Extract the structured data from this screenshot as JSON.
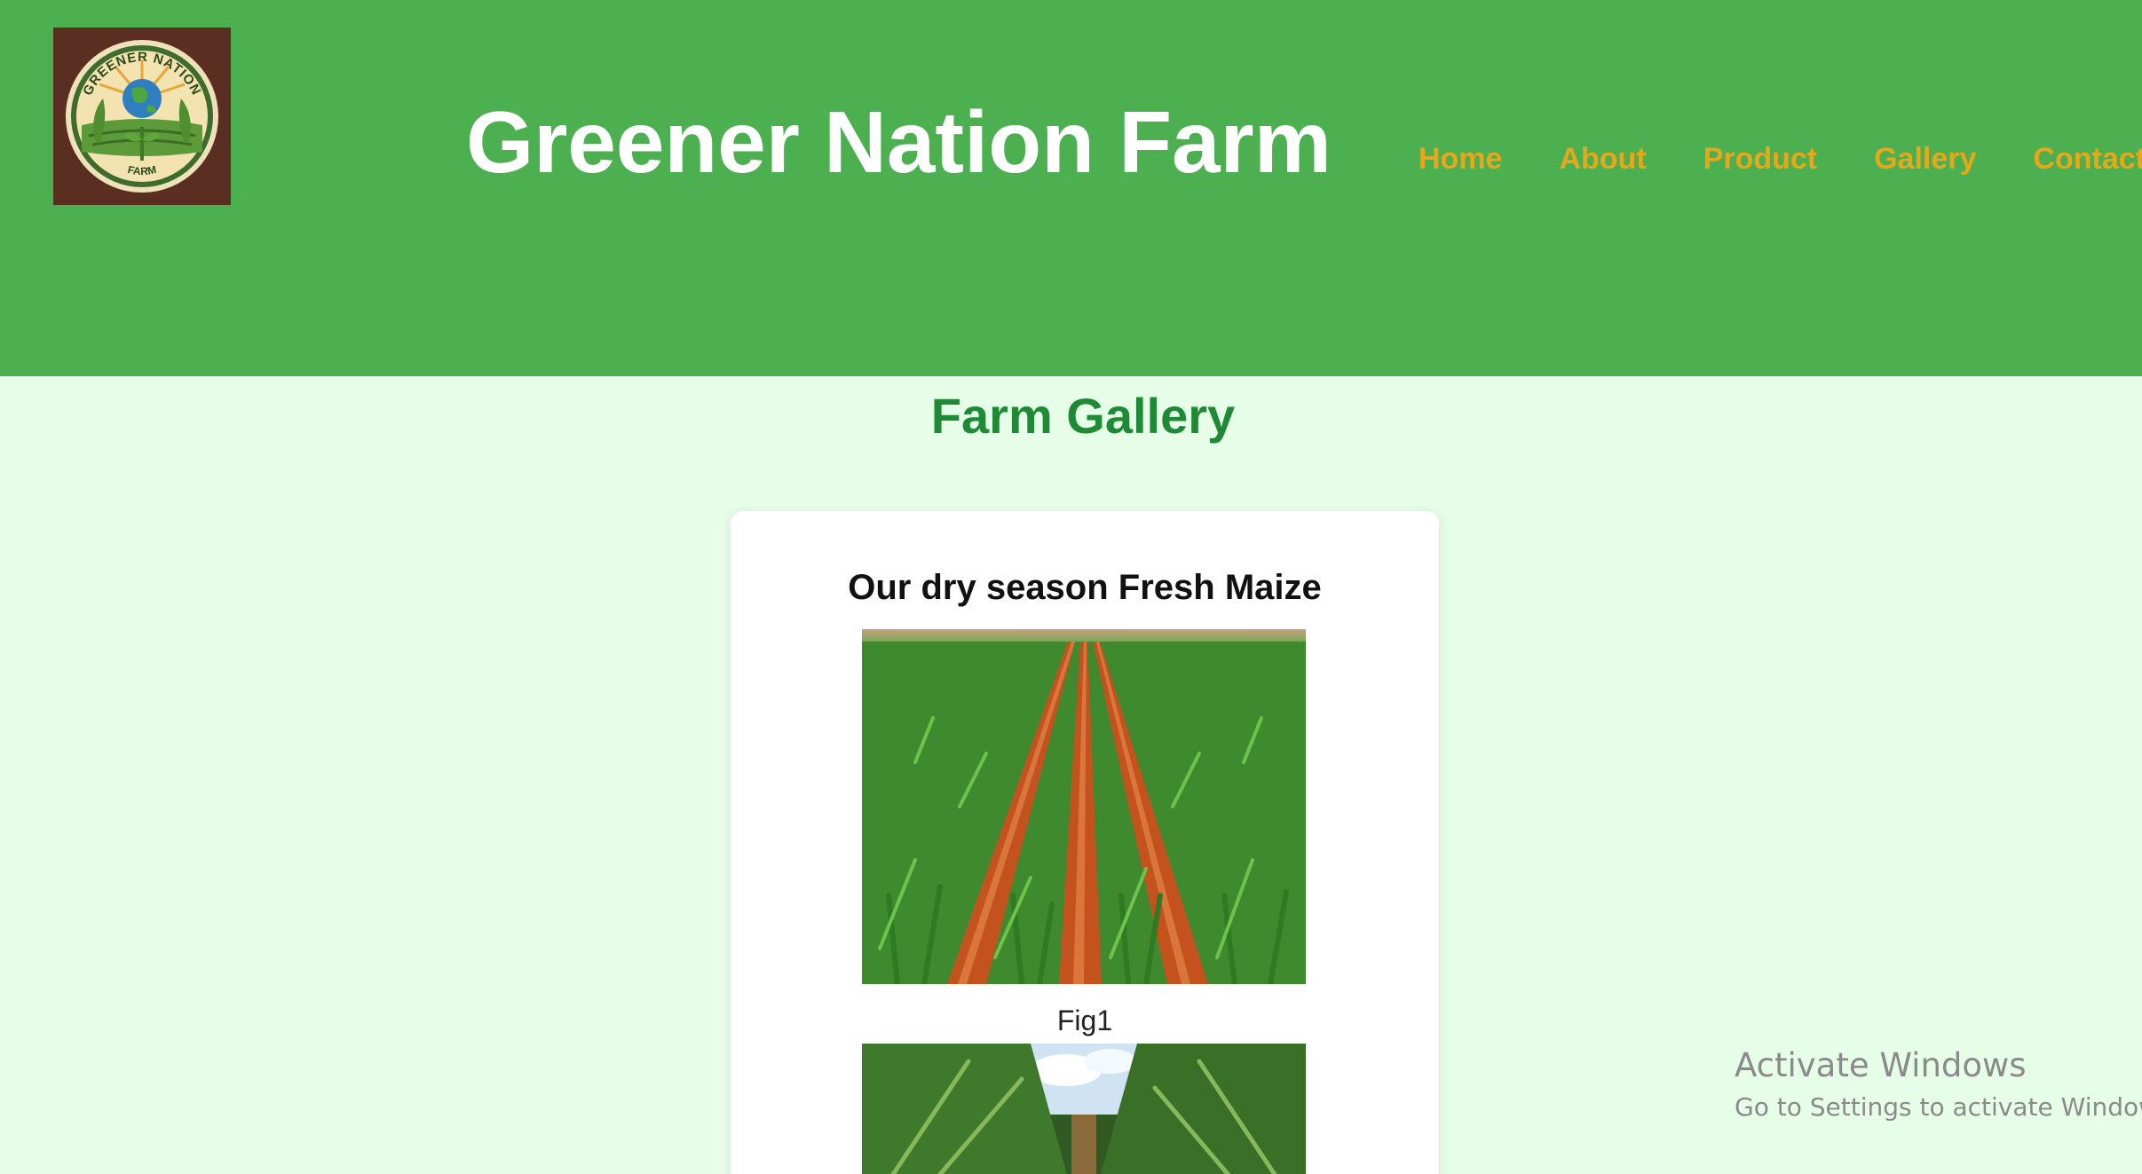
{
  "header": {
    "title": "Greener Nation Farm",
    "logo": {
      "ring_text_top": "GREENER NATION",
      "ring_text_bottom": "FARM",
      "icon": "globe-farm-logo"
    },
    "nav": [
      {
        "label": "Home"
      },
      {
        "label": "About"
      },
      {
        "label": "Product"
      },
      {
        "label": "Gallery"
      },
      {
        "label": "Contact"
      }
    ]
  },
  "main": {
    "heading": "Farm Gallery",
    "card": {
      "title": "Our dry season Fresh Maize",
      "figures": [
        {
          "caption": "Fig1",
          "subject": "maize-rows-red-soil"
        },
        {
          "caption": "",
          "subject": "mature-maize-sky"
        }
      ]
    }
  },
  "watermark": {
    "title": "Activate Windows",
    "subtitle": "Go to Settings to activate Windows."
  },
  "colors": {
    "header_bg": "#4caf50",
    "page_bg": "#e6fde8",
    "nav_link": "#e6a81a",
    "heading": "#1f8a36",
    "card_bg": "#ffffff"
  }
}
